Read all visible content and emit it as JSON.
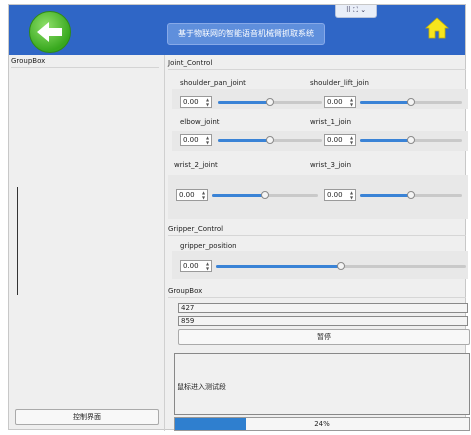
{
  "header": {
    "title": "基于物联网的智能语音机械臂抓取系统",
    "top_tab": "⠿ ⛶ ⌄"
  },
  "left": {
    "group_title": "GroupBox",
    "control_button": "控制界面"
  },
  "joint_control": {
    "title": "Joint_Control",
    "joints": [
      {
        "label": "shoulder_pan_joint",
        "value": "0.00",
        "fraction": 0.5
      },
      {
        "label": "shoulder_lift_join",
        "value": "0.00",
        "fraction": 0.5
      },
      {
        "label": "elbow_joint",
        "value": "0.00",
        "fraction": 0.5
      },
      {
        "label": "wrist_1_join",
        "value": "0.00",
        "fraction": 0.5
      },
      {
        "label": "wrist_2_joint",
        "value": "0.00",
        "fraction": 0.5
      },
      {
        "label": "wrist_3_join",
        "value": "0.00",
        "fraction": 0.5
      }
    ]
  },
  "gripper_control": {
    "title": "Gripper_Control",
    "label": "gripper_position",
    "value": "0.00",
    "fraction": 0.5
  },
  "status_group": {
    "title": "GroupBox",
    "field1": "427",
    "field2": "859",
    "pause_button": "暂停",
    "log_text": "鼠标进入测试段"
  },
  "progress": {
    "value": 0.24,
    "text": "24%"
  },
  "colors": {
    "header": "#2f66c6",
    "accent": "#3a83d6"
  }
}
